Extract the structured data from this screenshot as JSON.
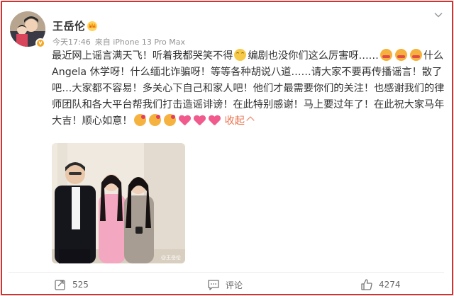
{
  "user": {
    "name": "王岳伦",
    "time": "今天17:46",
    "source": "来自 iPhone 13 Pro Max"
  },
  "post": {
    "text_1": "最近网上谣言满天飞！听着我都哭笑不得",
    "text_2": "编剧也没你们这么厉害呀……",
    "text_3": "什么Angela 休学呀！什么缅北诈骗呀！等等各种胡说八道……请大家不要再传播谣言！散了吧…大家都不容易！多关心下自己和家人吧！他们才最需要你们的关注！也感谢我们的律师团队和各大平台帮我们打击造谣诽谤！在此特别感谢！马上要过年了！在此祝大家马年大吉！顺心如意！",
    "collapse_label": "收起",
    "emoji_laugh": "laugh-cry-emoji",
    "emoji_group_1": [
      "cake-face-emoji",
      "cake-face-emoji",
      "cake-face-emoji"
    ],
    "emoji_group_2": [
      "kiss-face-emoji",
      "kiss-face-emoji",
      "kiss-face-emoji",
      "heart-emoji",
      "heart-emoji",
      "heart-emoji"
    ]
  },
  "image": {
    "watermark": "@王岳伦"
  },
  "actions": {
    "repost_count": "525",
    "comment_label": "评论",
    "like_count": "4274"
  },
  "colors": {
    "frame": "#d9302e",
    "link": "#eb7350",
    "text": "#333333",
    "meta": "#939393"
  }
}
